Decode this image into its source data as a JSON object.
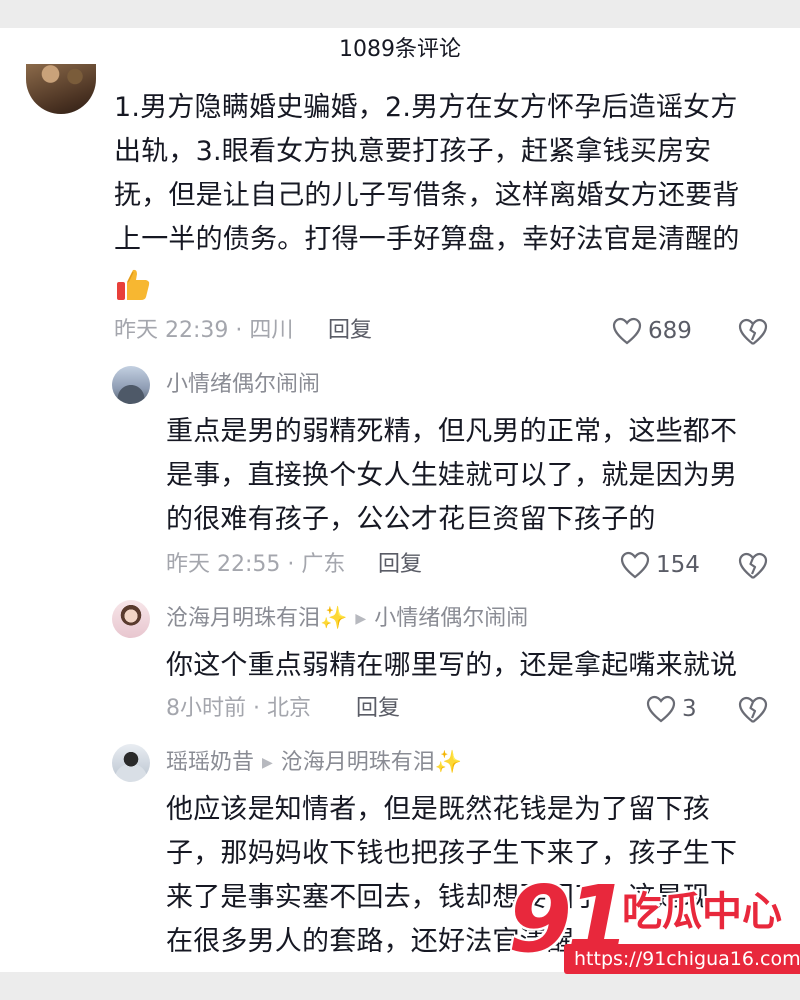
{
  "header": {
    "title": "1089条评论"
  },
  "colors": {
    "text": "#161823",
    "meta": "#a4a6ad",
    "accent_watermark": "#e8283c",
    "background": "#ffffff"
  },
  "comments": [
    {
      "lines": [
        "1.男方隐瞒婚史骗婚，2.男方在女方怀孕后造谣女方",
        "出轨，3.眼看女方执意要打孩子，赶紧拿钱买房安",
        "抚，但是让自己的儿子写借条，这样离婚女方还要背",
        "上一半的债务。打得一手好算盘，幸好法官是清醒的"
      ],
      "emoji": "thumbs-up-icon",
      "meta": "昨天 22:39 · 四川",
      "reply_label": "回复",
      "likes": "689"
    },
    {
      "username": "小情绪偶尔闹闹",
      "lines": [
        "重点是男的弱精死精，但凡男的正常，这些都不",
        "是事，直接换个女人生娃就可以了，就是因为男",
        "的很难有孩子，公公才花巨资留下孩子的"
      ],
      "meta": "昨天 22:55 · 广东",
      "reply_label": "回复",
      "likes": "154"
    },
    {
      "username": "沧海月明珠有泪",
      "username_sparkle": "✨",
      "reply_to": "小情绪偶尔闹闹",
      "lines": [
        "你这个重点弱精在哪里写的，还是拿起嘴来就说"
      ],
      "meta": "8小时前 · 北京",
      "reply_label": "回复",
      "likes": "3"
    },
    {
      "username": "瑶瑶奶昔",
      "reply_to": "沧海月明珠有泪",
      "reply_to_sparkle": "✨",
      "lines": [
        "他应该是知情者，但是既然花钱是为了留下孩",
        "子，那妈妈收下钱也把孩子生下来了，孩子生下",
        "来了是事实塞不回去，钱却想要回了，这是现",
        "在很多男人的套路，还好法官清醒"
      ]
    }
  ],
  "watermark": {
    "number": "91",
    "name": "吃瓜中心",
    "url": "https://91chigua16.com"
  }
}
